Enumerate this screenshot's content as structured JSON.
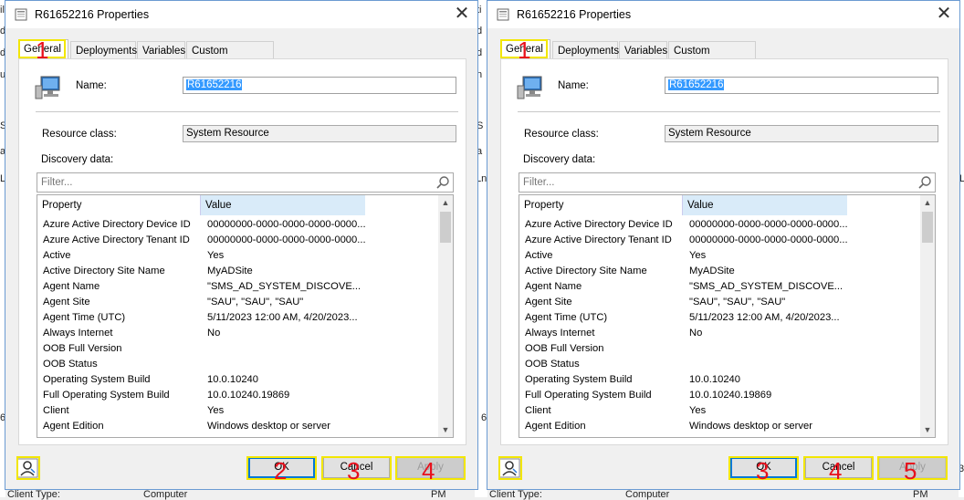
{
  "background": {
    "left_frags": [
      "ili",
      "d",
      "d",
      "u",
      "S",
      "a",
      "L",
      "6"
    ],
    "right_frags": [
      "ti",
      "d",
      "d",
      "n",
      "S",
      "a",
      "Ln",
      "6",
      "L"
    ],
    "bottom_left": {
      "label": "Client Type:",
      "value": "Computer",
      "tail": "PM"
    },
    "bottom_right": {
      "label": "Client Type:",
      "value": "Computer",
      "tail": "PM"
    },
    "edge_digit": "3"
  },
  "windows": [
    {
      "title": "R61652216 Properties",
      "tabs": [
        "General",
        "Deployments",
        "Variables",
        "Custom Properties"
      ],
      "name_label": "Name:",
      "name_value": "R61652216",
      "resource_class_label": "Resource class:",
      "resource_class_value": "System Resource",
      "discovery_label": "Discovery data:",
      "filter_placeholder": "Filter...",
      "columns": {
        "property": "Property",
        "value": "Value"
      },
      "rows": [
        {
          "p": "Azure Active Directory Device ID",
          "v": "00000000-0000-0000-0000-0000..."
        },
        {
          "p": "Azure Active Directory Tenant ID",
          "v": "00000000-0000-0000-0000-0000..."
        },
        {
          "p": "Active",
          "v": "Yes"
        },
        {
          "p": "Active Directory Site Name",
          "v": "MyADSite"
        },
        {
          "p": "Agent Name",
          "v": "\"SMS_AD_SYSTEM_DISCOVE..."
        },
        {
          "p": "Agent Site",
          "v": "\"SAU\", \"SAU\", \"SAU\""
        },
        {
          "p": "Agent Time (UTC)",
          "v": "5/11/2023 12:00 AM, 4/20/2023..."
        },
        {
          "p": "Always Internet",
          "v": "No"
        },
        {
          "p": "OOB Full Version",
          "v": ""
        },
        {
          "p": "OOB Status",
          "v": ""
        },
        {
          "p": "Operating System Build",
          "v": "10.0.10240"
        },
        {
          "p": "Full Operating System Build",
          "v": "10.0.10240.19869"
        },
        {
          "p": "Client",
          "v": "Yes"
        },
        {
          "p": "Agent Edition",
          "v": "Windows desktop or server"
        }
      ],
      "buttons": {
        "ok": "OK",
        "cancel": "Cancel",
        "apply": "Apply"
      },
      "markers": {
        "tab": "1",
        "ok": "2",
        "cancel": "3",
        "apply": "4"
      }
    },
    {
      "title": "R61652216 Properties",
      "tabs": [
        "General",
        "Deployments",
        "Variables",
        "Custom Properties"
      ],
      "name_label": "Name:",
      "name_value": "R61652216",
      "resource_class_label": "Resource class:",
      "resource_class_value": "System Resource",
      "discovery_label": "Discovery data:",
      "filter_placeholder": "Filter...",
      "columns": {
        "property": "Property",
        "value": "Value"
      },
      "rows": [
        {
          "p": "Azure Active Directory Device ID",
          "v": "00000000-0000-0000-0000-0000..."
        },
        {
          "p": "Azure Active Directory Tenant ID",
          "v": "00000000-0000-0000-0000-0000..."
        },
        {
          "p": "Active",
          "v": "Yes"
        },
        {
          "p": "Active Directory Site Name",
          "v": "MyADSite"
        },
        {
          "p": "Agent Name",
          "v": "\"SMS_AD_SYSTEM_DISCOVE..."
        },
        {
          "p": "Agent Site",
          "v": "\"SAU\", \"SAU\", \"SAU\""
        },
        {
          "p": "Agent Time (UTC)",
          "v": "5/11/2023 12:00 AM, 4/20/2023..."
        },
        {
          "p": "Always Internet",
          "v": "No"
        },
        {
          "p": "OOB Full Version",
          "v": ""
        },
        {
          "p": "OOB Status",
          "v": ""
        },
        {
          "p": "Operating System Build",
          "v": "10.0.10240"
        },
        {
          "p": "Full Operating System Build",
          "v": "10.0.10240.19869"
        },
        {
          "p": "Client",
          "v": "Yes"
        },
        {
          "p": "Agent Edition",
          "v": "Windows desktop or server"
        }
      ],
      "buttons": {
        "ok": "OK",
        "cancel": "Cancel",
        "apply": "Apply"
      },
      "markers": {
        "tab": "1",
        "ok": "3",
        "cancel": "4",
        "apply": "5"
      }
    }
  ]
}
